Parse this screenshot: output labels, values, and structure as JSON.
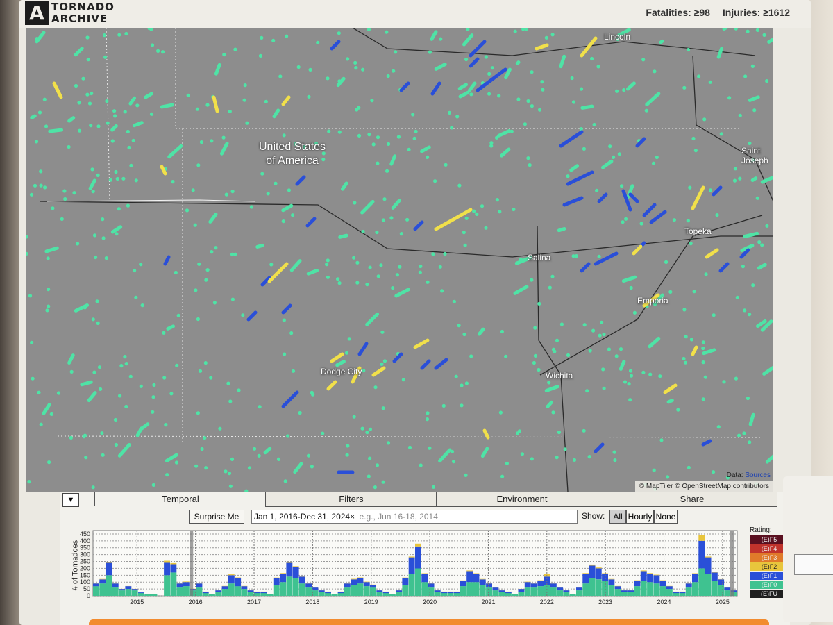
{
  "header": {
    "logo_mark": "A",
    "logo_line1": "TORNADO",
    "logo_line2": "ARCHIVE",
    "fatalities": "Fatalities: ≥98",
    "injuries": "Injuries: ≥1612"
  },
  "map": {
    "country_line1": "United States",
    "country_line2": "of America",
    "cities": [
      "Lincoln",
      "Saint Joseph",
      "Topeka",
      "Salina",
      "Emporia",
      "Dodge City",
      "Wichita"
    ],
    "data_label": "Data:",
    "data_link": "Sources",
    "attribution": "© MapTiler © OpenStreetMap contributors",
    "colors": {
      "background": "#8d8d8d",
      "EF0": "#4fe3a6",
      "EF1": "#2a4fd8",
      "EF2": "#f1e04a"
    }
  },
  "panel": {
    "toggle_icon": "▼",
    "tabs": [
      "Temporal",
      "Filters",
      "Environment",
      "Share"
    ],
    "active_tab": "Temporal",
    "surprise_label": "Surprise Me",
    "date_chip": "Jan 1, 2016-Dec 31, 2024×",
    "date_placeholder": "e.g., Jun 16-18, 2014",
    "show_label": "Show:",
    "show_options": [
      "All",
      "Hourly",
      "None"
    ],
    "show_selected": "All"
  },
  "chart_data": {
    "type": "bar",
    "stacked": true,
    "ylabel": "# of Tornadoes",
    "yticks": [
      0,
      50,
      100,
      150,
      200,
      250,
      300,
      350,
      400,
      450
    ],
    "ylim": [
      0,
      475
    ],
    "xticks": [
      "2015",
      "2016",
      "2017",
      "2018",
      "2019",
      "2020",
      "2021",
      "2022",
      "2023",
      "2024",
      "2025"
    ],
    "legend_title": "Rating:",
    "legend": [
      "(E)F5",
      "(E)F4",
      "(E)F3",
      "(E)F2",
      "(E)F1",
      "(E)F0",
      "(E)FU"
    ],
    "legend_colors": [
      "#5a1020",
      "#c0332c",
      "#e07a2a",
      "#e8c53c",
      "#2a4fd8",
      "#3fc290",
      "#1f1f1f"
    ],
    "series": [
      {
        "name": "(E)F0",
        "values": [
          70,
          90,
          150,
          60,
          40,
          50,
          40,
          20,
          10,
          10,
          0,
          150,
          170,
          60,
          70,
          40,
          60,
          20,
          10,
          30,
          50,
          90,
          70,
          50,
          30,
          20,
          20,
          10,
          80,
          100,
          140,
          130,
          90,
          60,
          40,
          30,
          20,
          10,
          20,
          60,
          80,
          90,
          70,
          60,
          30,
          20,
          10,
          30,
          80,
          160,
          200,
          100,
          60,
          30,
          20,
          20,
          20,
          70,
          100,
          100,
          80,
          60,
          40,
          30,
          20,
          10,
          30,
          60,
          60,
          70,
          80,
          60,
          40,
          30,
          10,
          40,
          90,
          130,
          120,
          110,
          80,
          50,
          30,
          30,
          70,
          110,
          100,
          90,
          70,
          50,
          20,
          20,
          60,
          100,
          200,
          160,
          110,
          80,
          40,
          30
        ]
      },
      {
        "name": "(E)F1",
        "values": [
          20,
          30,
          90,
          30,
          10,
          20,
          10,
          5,
          5,
          5,
          0,
          90,
          60,
          30,
          30,
          10,
          30,
          10,
          5,
          10,
          20,
          60,
          60,
          20,
          10,
          10,
          10,
          5,
          50,
          60,
          100,
          80,
          50,
          30,
          20,
          10,
          10,
          5,
          10,
          30,
          40,
          40,
          30,
          20,
          10,
          10,
          5,
          10,
          50,
          120,
          160,
          60,
          30,
          10,
          10,
          10,
          10,
          40,
          80,
          60,
          40,
          30,
          20,
          10,
          10,
          5,
          20,
          40,
          30,
          40,
          60,
          30,
          20,
          10,
          5,
          20,
          70,
          90,
          80,
          50,
          40,
          20,
          10,
          10,
          40,
          70,
          60,
          60,
          40,
          20,
          10,
          10,
          30,
          60,
          200,
          120,
          60,
          40,
          20,
          10
        ]
      },
      {
        "name": "(E)F2",
        "values": [
          2,
          3,
          5,
          2,
          1,
          1,
          1,
          0,
          0,
          0,
          0,
          15,
          8,
          3,
          4,
          2,
          3,
          1,
          0,
          2,
          2,
          6,
          4,
          2,
          1,
          1,
          1,
          0,
          3,
          5,
          6,
          6,
          4,
          2,
          1,
          1,
          1,
          0,
          1,
          3,
          4,
          4,
          3,
          2,
          1,
          1,
          0,
          1,
          3,
          6,
          20,
          4,
          3,
          1,
          1,
          1,
          1,
          2,
          5,
          4,
          3,
          2,
          1,
          1,
          1,
          0,
          1,
          3,
          2,
          3,
          20,
          2,
          1,
          1,
          0,
          1,
          5,
          8,
          6,
          4,
          3,
          2,
          1,
          1,
          3,
          5,
          5,
          4,
          3,
          2,
          1,
          1,
          2,
          4,
          40,
          6,
          4,
          2,
          1,
          1
        ]
      }
    ]
  }
}
